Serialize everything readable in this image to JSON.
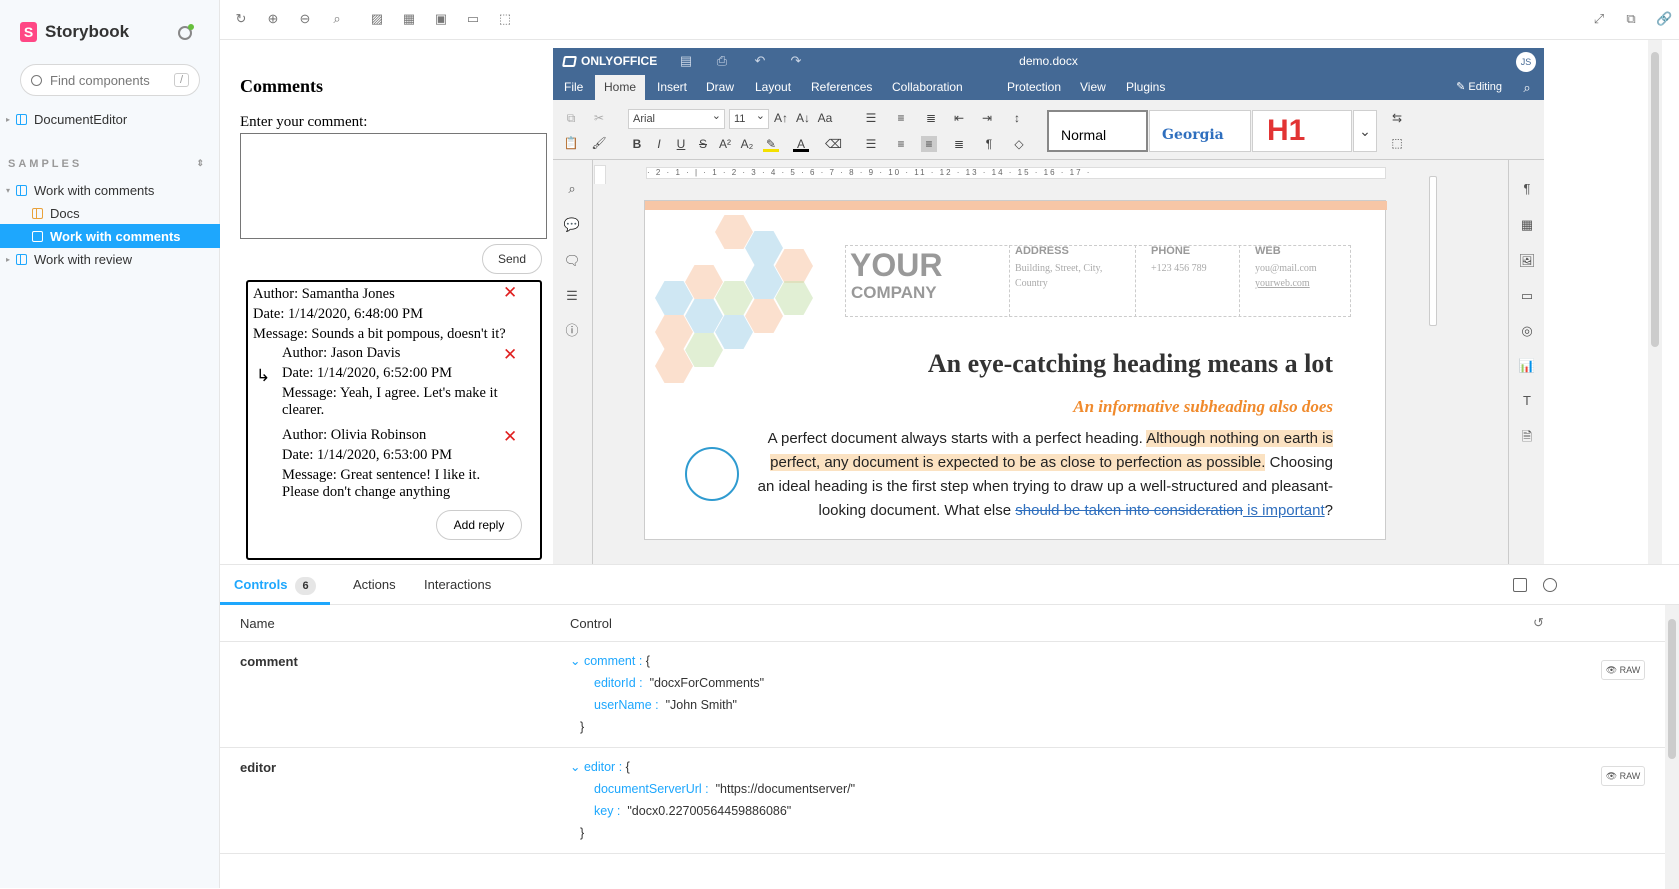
{
  "sidebar": {
    "brand": "Storybook",
    "search_placeholder": "Find components",
    "search_shortcut": "/",
    "items": [
      {
        "label": "DocumentEditor"
      },
      {
        "label": "Work with comments"
      },
      {
        "label": "Docs"
      },
      {
        "label": "Work with comments"
      },
      {
        "label": "Work with review"
      }
    ],
    "section_title": "SAMPLES"
  },
  "comments_panel": {
    "title": "Comments",
    "input_label": "Enter your comment:",
    "send_label": "Send",
    "add_reply_label": "Add reply",
    "thread": {
      "author": "Author: Samantha Jones",
      "date": "Date: 1/14/2020, 6:48:00 PM",
      "message": "Message: Sounds a bit pompous, doesn't it?",
      "replies": [
        {
          "author": "Author: Jason Davis",
          "date": "Date: 1/14/2020, 6:52:00 PM",
          "message1": "Message: Yeah, I agree. Let's make it",
          "message2": "clearer."
        },
        {
          "author": "Author: Olivia Robinson",
          "date": "Date: 1/14/2020, 6:53:00 PM",
          "message1": "Message: Great sentence! I like it.",
          "message2": "Please don't change anything"
        }
      ]
    }
  },
  "editor": {
    "brand": "ONLYOFFICE",
    "doc_title": "demo.docx",
    "avatar": "JS",
    "tabs": [
      "File",
      "Home",
      "Insert",
      "Draw",
      "Layout",
      "References",
      "Collaboration",
      "Protection",
      "View",
      "Plugins"
    ],
    "mode": "Editing",
    "font": "Arial",
    "size": "11",
    "styles": {
      "normal": "Normal",
      "georgia": "Georgia",
      "h1": "H1"
    },
    "ruler": "· 2 · 1 · | · 1 · 2 · 3 · 4 · 5 · 6 · 7 · 8 · 9 · 10 · 11 · 12 · 13 · 14 · 15 · 16 · 17 ·",
    "page": {
      "your": "YOUR",
      "company": "COMPANY",
      "address_h": "ADDRESS",
      "address_v1": "Building, Street, City,",
      "address_v2": "Country",
      "phone_h": "PHONE",
      "phone_v": "+123 456 789",
      "web_h": "WEB",
      "web_v1": "you@mail.com",
      "web_v2": "yourweb.com",
      "heading": "An eye-catching heading means a lot",
      "subheading": "An informative subheading also does",
      "p1": "A perfect document always starts with a perfect heading.",
      "p2": "Although nothing on earth is perfect, any document is expected to be as close to perfection as possible.",
      "p3": "Choosing an ideal heading is the first step when trying to draw up a well-structured and pleasant-looking document. What else",
      "deleted": "should be taken into consideration",
      "inserted": " is important",
      "end": "?"
    }
  },
  "addons": {
    "tabs": [
      {
        "label": "Controls",
        "badge": "6"
      },
      {
        "label": "Actions"
      },
      {
        "label": "Interactions"
      }
    ],
    "col_name": "Name",
    "col_control": "Control",
    "rows": [
      {
        "name": "comment",
        "obj_key": "comment :",
        "obj_open": "{",
        "k1": "editorId :",
        "v1": "\"docxForComments\"",
        "k2": "userName :",
        "v2": "\"John Smith\"",
        "close": "}"
      },
      {
        "name": "editor",
        "obj_key": "editor :",
        "obj_open": "{",
        "k1": "documentServerUrl :",
        "v1": "\"https://documentserver/\"",
        "k2": "key :",
        "v2": "\"docx0.22700564459886086\"",
        "close": "}"
      }
    ],
    "raw_label": "RAW"
  }
}
